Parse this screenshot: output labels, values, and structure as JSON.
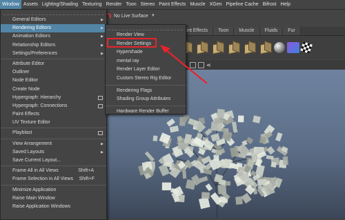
{
  "menubar": {
    "items": [
      "Window",
      "Assets",
      "Lighting/Shading",
      "Texturing",
      "Render",
      "Toon",
      "Stereo",
      "Paint Effects",
      "Muscle",
      "XGen",
      "Pipeline Cache",
      "Bifrost",
      "Help"
    ],
    "active_index": 0
  },
  "status": {
    "live_surface": "No Live Surface"
  },
  "shelf": {
    "tabs": [
      "Paint Effects",
      "Toon",
      "Muscle",
      "Fluids",
      "Fur"
    ],
    "tools": [
      "cube-icon",
      "cube-icon",
      "cube-icon",
      "cube-icon",
      "cube-icon",
      "cube-icon",
      "sphere-icon",
      "fur-icon",
      "checker-icon"
    ]
  },
  "window_menu": {
    "items": [
      {
        "label": "General Editors",
        "submenu": true
      },
      {
        "label": "Rendering Editors",
        "submenu": true,
        "highlighted": true
      },
      {
        "label": "Animation Editors",
        "submenu": true
      },
      {
        "label": "Relationship Editors",
        "submenu": true
      },
      {
        "label": "Settings/Preferences",
        "submenu": true
      },
      {
        "label": "Attribute Editor"
      },
      {
        "label": "Outliner"
      },
      {
        "label": "Node Editor"
      },
      {
        "label": "Create Node"
      },
      {
        "label": "Hypergraph: Hierarchy",
        "option": true
      },
      {
        "label": "Hypergraph: Connections",
        "option": true
      },
      {
        "label": "Paint Effects"
      },
      {
        "label": "UV Texture Editor"
      },
      {
        "label": "Playblast",
        "option": true
      },
      {
        "label": "View Arrangement",
        "submenu": true
      },
      {
        "label": "Saved Layouts",
        "submenu": true
      },
      {
        "label": "Save Current Layout..."
      },
      {
        "label": "Frame All in All Views",
        "shortcut": "Shift+A"
      },
      {
        "label": "Frame Selection in All Views",
        "shortcut": "Shift+F"
      },
      {
        "label": "Minimize Application"
      },
      {
        "label": "Raise Main Window"
      },
      {
        "label": "Raise Application Windows"
      }
    ]
  },
  "rendering_submenu": {
    "items": [
      {
        "label": "Render View"
      },
      {
        "label": "Render Settings",
        "annotated": true
      },
      {
        "label": "Hypershade"
      },
      {
        "label": "mental ray"
      },
      {
        "label": "Render Layer Editor"
      },
      {
        "label": "Custom Stereo Rig Editor"
      },
      {
        "label": "Rendering Flags"
      },
      {
        "label": "Shading Group Attributes"
      },
      {
        "label": "Hardware Render Buffer"
      }
    ]
  },
  "colors": {
    "highlight": "#5285a6",
    "annotation": "#e8242b",
    "menu_bg": "#444444"
  }
}
